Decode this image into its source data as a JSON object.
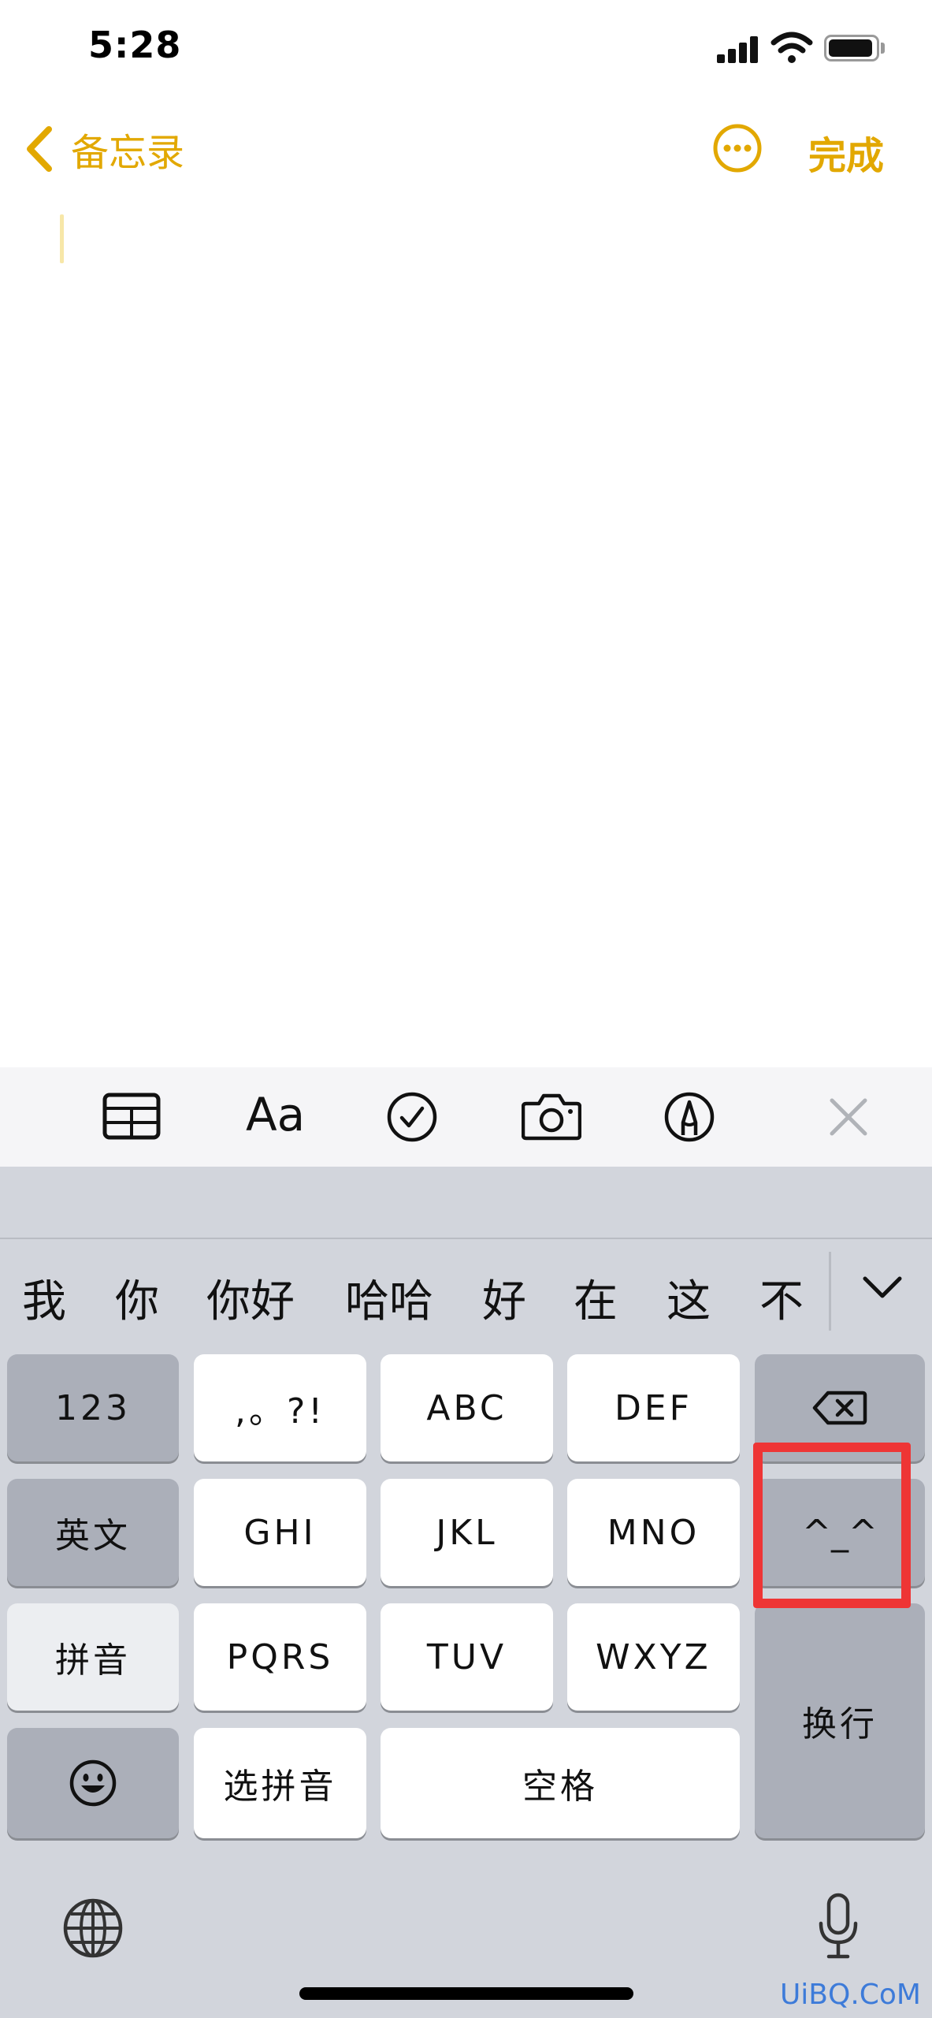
{
  "status_bar": {
    "time": "5:28"
  },
  "nav": {
    "back_label": "备忘录",
    "done_label": "完成"
  },
  "toolbar": {
    "text_format_label": "Aa"
  },
  "candidates": [
    "我",
    "你",
    "你好",
    "哈哈",
    "好",
    "在",
    "这",
    "不"
  ],
  "keyboard": {
    "numbers": "123",
    "punct": ",。?!",
    "abc": "ABC",
    "def": "DEF",
    "english": "英文",
    "ghi": "GHI",
    "jkl": "JKL",
    "mno": "MNO",
    "emoticon": "^_^",
    "pinyin": "拼音",
    "pqrs": "PQRS",
    "tuv": "TUV",
    "wxyz": "WXYZ",
    "return": "换行",
    "select_pinyin": "选拼音",
    "space": "空格"
  },
  "watermark": "UiBQ.CoM",
  "colors": {
    "accent": "#e2a800",
    "highlight": "#ee3535",
    "keyboard_bg": "#d2d5dc"
  }
}
